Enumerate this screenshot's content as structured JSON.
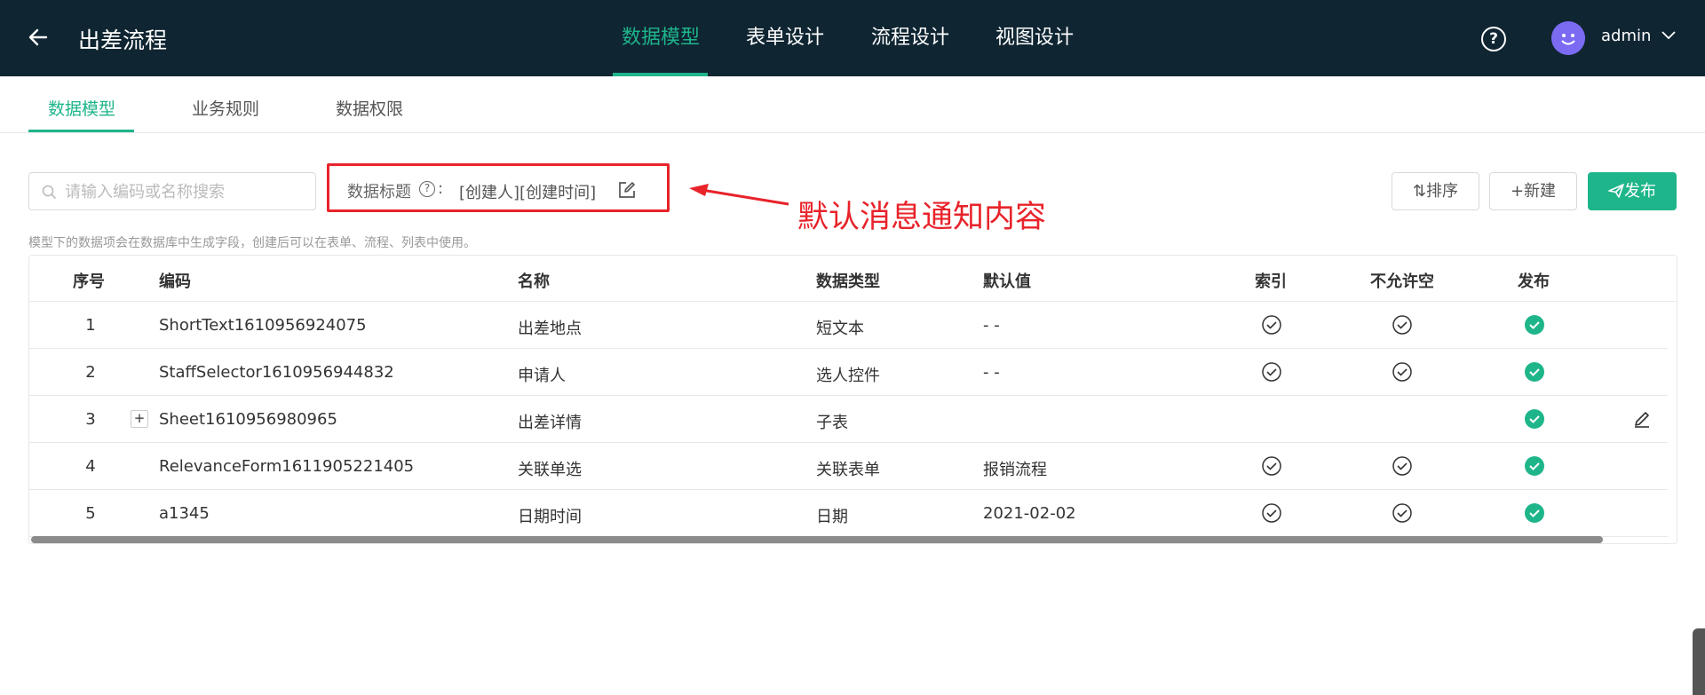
{
  "header": {
    "title": "出差流程",
    "nav": [
      {
        "label": "数据模型",
        "active": true
      },
      {
        "label": "表单设计",
        "active": false
      },
      {
        "label": "流程设计",
        "active": false
      },
      {
        "label": "视图设计",
        "active": false
      }
    ],
    "help_icon": "question-circle-icon",
    "user": {
      "name": "admin"
    }
  },
  "subtabs": [
    {
      "label": "数据模型",
      "active": true
    },
    {
      "label": "业务规则",
      "active": false
    },
    {
      "label": "数据权限",
      "active": false
    }
  ],
  "toolbar": {
    "search_placeholder": "请输入编码或名称搜索",
    "title_label": "数据标题",
    "title_colon": ":",
    "title_value": "[创建人][创建时间]",
    "sort_label": "⇅排序",
    "new_label": "+新建",
    "publish_label": "发布"
  },
  "annotation": {
    "text": "默认消息通知内容",
    "color": "#e8232a"
  },
  "hint": "模型下的数据项会在数据库中生成字段，创建后可以在表单、流程、列表中使用。",
  "table": {
    "columns": [
      "序号",
      "编码",
      "名称",
      "数据类型",
      "默认值",
      "索引",
      "不允许空",
      "发布"
    ],
    "rows": [
      {
        "no": "1",
        "code": "ShortText1610956924075",
        "name": "出差地点",
        "type": "短文本",
        "default": "- -",
        "index": true,
        "required": true,
        "published": true,
        "expandable": false,
        "editable": false
      },
      {
        "no": "2",
        "code": "StaffSelector1610956944832",
        "name": "申请人",
        "type": "选人控件",
        "default": "- -",
        "index": true,
        "required": true,
        "published": true,
        "expandable": false,
        "editable": false
      },
      {
        "no": "3",
        "code": "Sheet1610956980965",
        "name": "出差详情",
        "type": "子表",
        "default": "",
        "index": false,
        "required": false,
        "published": true,
        "expandable": true,
        "editable": true
      },
      {
        "no": "4",
        "code": "RelevanceForm1611905221405",
        "name": "关联单选",
        "type": "关联表单",
        "default": "报销流程",
        "index": true,
        "required": true,
        "published": true,
        "expandable": false,
        "editable": false
      },
      {
        "no": "5",
        "code": "a1345",
        "name": "日期时间",
        "type": "日期",
        "default": "2021-02-02",
        "index": true,
        "required": true,
        "published": true,
        "expandable": false,
        "editable": false
      }
    ]
  },
  "colors": {
    "header_bg": "#0f2532",
    "accent": "#1fb58b"
  }
}
